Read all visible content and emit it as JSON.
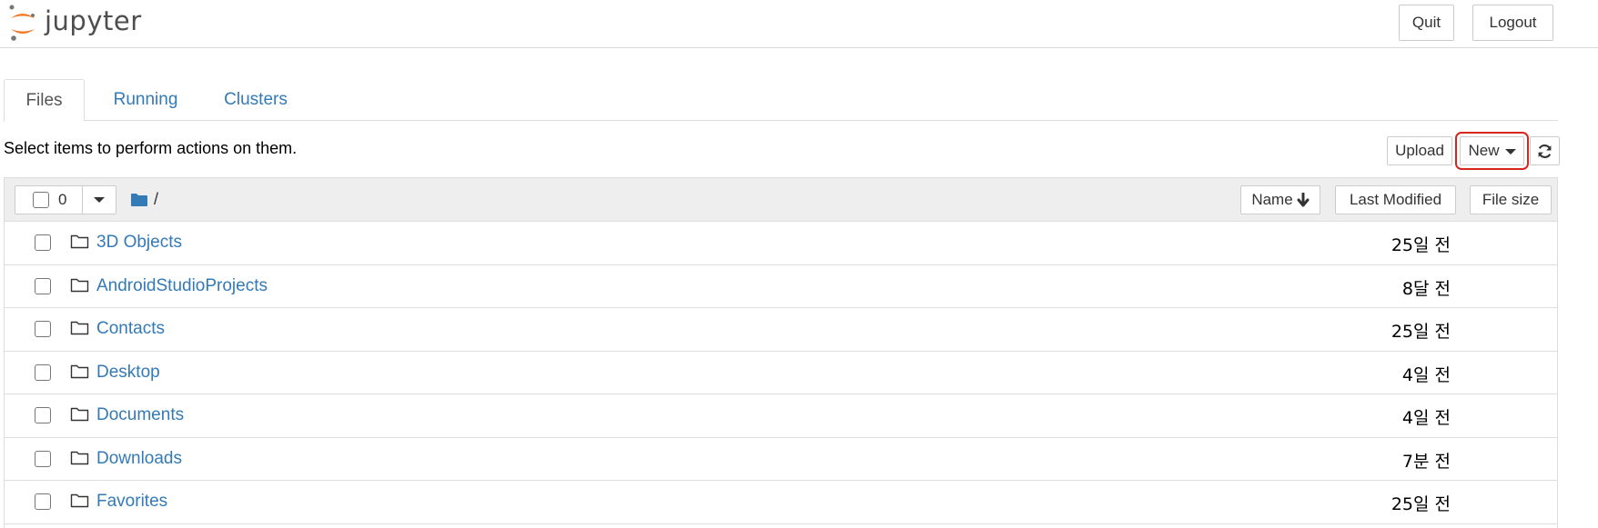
{
  "header": {
    "logo_text": "jupyter",
    "quit_label": "Quit",
    "logout_label": "Logout"
  },
  "tabs": [
    {
      "label": "Files",
      "active": true
    },
    {
      "label": "Running",
      "active": false
    },
    {
      "label": "Clusters",
      "active": false
    }
  ],
  "toolbar": {
    "instruction": "Select items to perform actions on them.",
    "upload_label": "Upload",
    "new_label": "New",
    "refresh_icon": "refresh-icon"
  },
  "list_header": {
    "selected_count": "0",
    "breadcrumb": "/",
    "sort_name_label": "Name",
    "sort_modified_label": "Last Modified",
    "sort_size_label": "File size"
  },
  "files": [
    {
      "name": "3D Objects",
      "modified": "25일 전"
    },
    {
      "name": "AndroidStudioProjects",
      "modified": "8달 전"
    },
    {
      "name": "Contacts",
      "modified": "25일 전"
    },
    {
      "name": "Desktop",
      "modified": "4일 전"
    },
    {
      "name": "Documents",
      "modified": "4일 전"
    },
    {
      "name": "Downloads",
      "modified": "7분 전"
    },
    {
      "name": "Favorites",
      "modified": "25일 전"
    }
  ],
  "colors": {
    "link": "#337ab7",
    "highlight": "#d9261c",
    "logo_orange": "#f37726"
  }
}
